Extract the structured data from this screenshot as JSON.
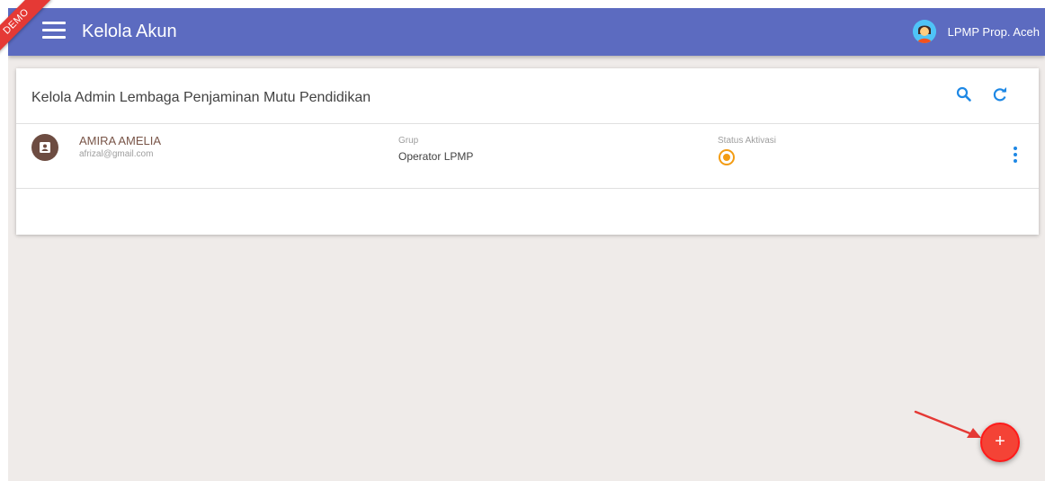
{
  "appbar": {
    "title": "Kelola Akun",
    "demo_ribbon": "DEMO",
    "user_name": "LPMP Prop. Aceh",
    "color": "#5c6bc0"
  },
  "card": {
    "title": "Kelola Admin Lembaga Penjaminan Mutu Pendidikan",
    "actions": [
      "search-icon",
      "refresh-icon"
    ]
  },
  "accounts": [
    {
      "name": "AMIRA AMELIA",
      "email": "afrizal@gmail.com",
      "group_label": "Grup",
      "group_value": "Operator LPMP",
      "status_label": "Status Aktivasi",
      "status_active": true
    }
  ],
  "fab": {
    "label": "+",
    "color": "#f44336"
  },
  "colors": {
    "accent_blue": "#1e88e5",
    "status_orange": "#f39c12",
    "avatar_brown": "#6d4c41",
    "background": "#efebe9"
  }
}
